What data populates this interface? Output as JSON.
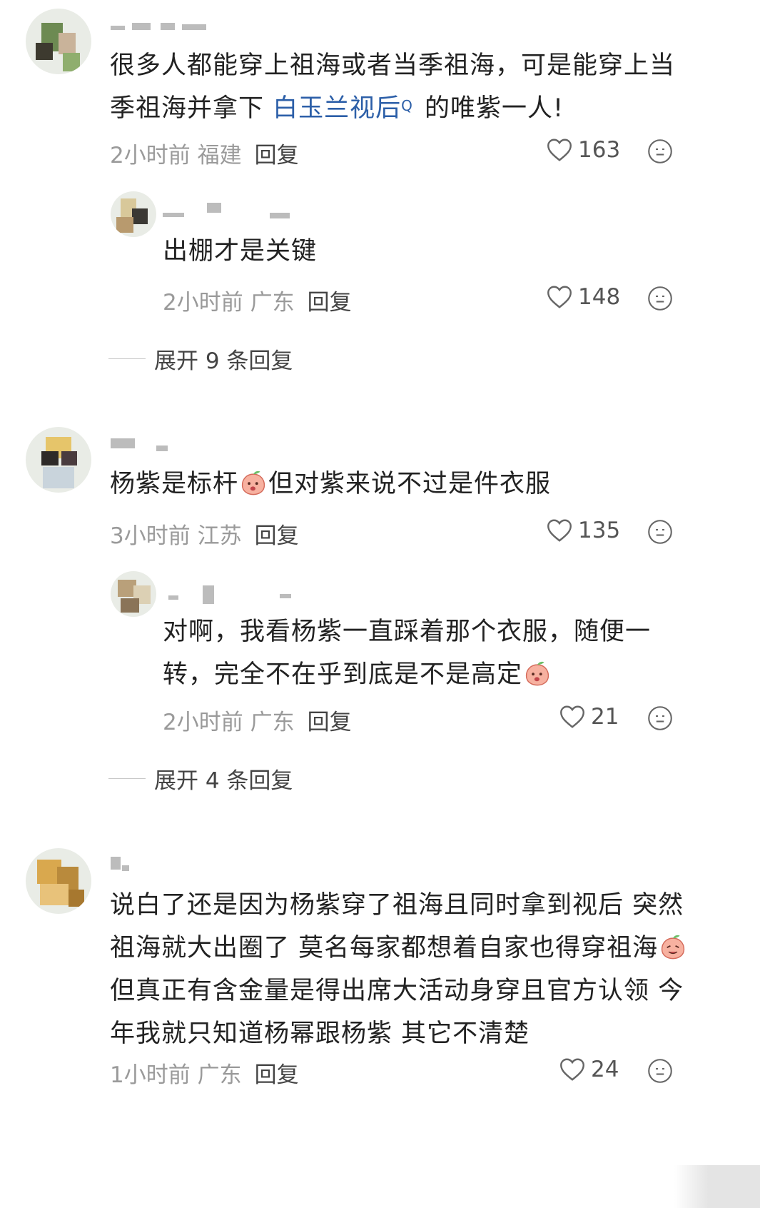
{
  "comments": [
    {
      "text_lines": [
        "很多人都能穿上祖海或者当季祖海，可是能穿上当",
        "季祖海并拿下 "
      ],
      "link": "白玉兰视后",
      "link_sup": "Q",
      "after_link": " 的唯紫一人!",
      "time": "2小时前",
      "location": "福建",
      "reply": "回复",
      "likes": "163"
    },
    {
      "text_lines": [
        "出棚才是关键"
      ],
      "time": "2小时前",
      "location": "广东",
      "reply": "回复",
      "likes": "148"
    },
    {
      "expand": "展开 9 条回复"
    },
    {
      "text_before": "杨紫是标杆",
      "text_after": "但对紫来说不过是件衣服",
      "time": "3小时前",
      "location": "江苏",
      "reply": "回复",
      "likes": "135"
    },
    {
      "text_lines": [
        "对啊，我看杨紫一直踩着那个衣服，随便一",
        "转，完全不在乎到底是不是高定"
      ],
      "time": "2小时前",
      "location": "广东",
      "reply": "回复",
      "likes": "21"
    },
    {
      "expand": "展开 4 条回复"
    },
    {
      "text_lines": [
        "说白了还是因为杨紫穿了祖海且同时拿到视后 突然",
        "祖海就大出圈了 莫名每家都想着自家也得穿祖海",
        "但真正有含金量是得出席大活动身穿且官方认领 今",
        "年我就只知道杨幂跟杨紫 其它不清楚"
      ],
      "time": "1小时前",
      "location": "广东",
      "reply": "回复",
      "likes": "24"
    }
  ],
  "icons": {
    "like": "heart-outline-icon",
    "react": "face-reaction-icon",
    "emoji": "peach-emoji-icon"
  }
}
